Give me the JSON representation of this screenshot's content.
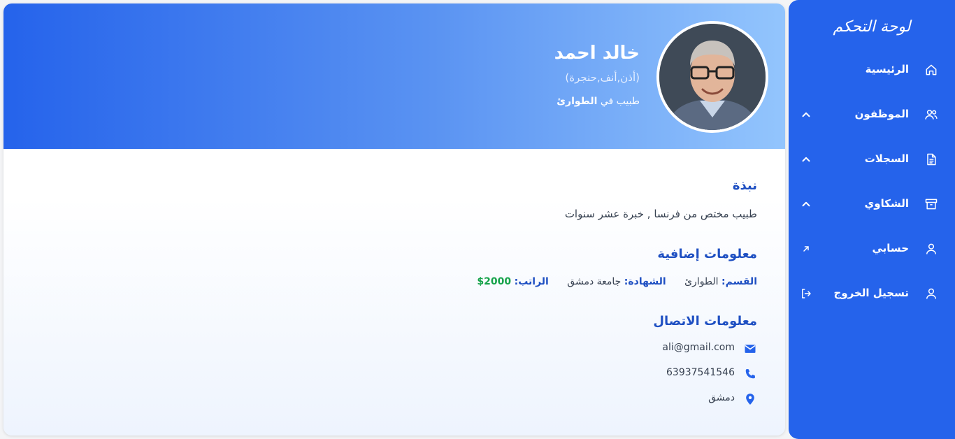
{
  "sidebar": {
    "title": "لوحة التحكم",
    "items": [
      {
        "label": "الرئيسية",
        "icon": "home-icon"
      },
      {
        "label": "الموظفون",
        "icon": "users-icon"
      },
      {
        "label": "السجلات",
        "icon": "document-icon"
      },
      {
        "label": "الشكاوي",
        "icon": "archive-icon"
      },
      {
        "label": "حسابي",
        "icon": "user-icon"
      },
      {
        "label": "تسجيل الخروج",
        "icon": "user-icon"
      }
    ]
  },
  "profile": {
    "name": "خالد احمد",
    "specialty": "(أذن,أنف,حنجرة)",
    "role_prefix": "طبيب في",
    "role_department": "الطوارئ"
  },
  "about": {
    "title": "نبذة",
    "text": "طبيب مختص من فرنسا , خبرة عشر سنوات"
  },
  "extra": {
    "title": "معلومات إضافية",
    "department_label": "القسم:",
    "department_value": "الطوارئ",
    "degree_label": "الشهادة:",
    "degree_value": "جامعة دمشق",
    "salary_label": "الراتب:",
    "salary_value": "2000$"
  },
  "contact": {
    "title": "معلومات الاتصال",
    "email": "ali@gmail.com",
    "phone": "63937541546",
    "location": "دمشق"
  },
  "colors": {
    "primary": "#2563eb",
    "heading": "#1e4fc2",
    "salary": "#16a34a"
  }
}
